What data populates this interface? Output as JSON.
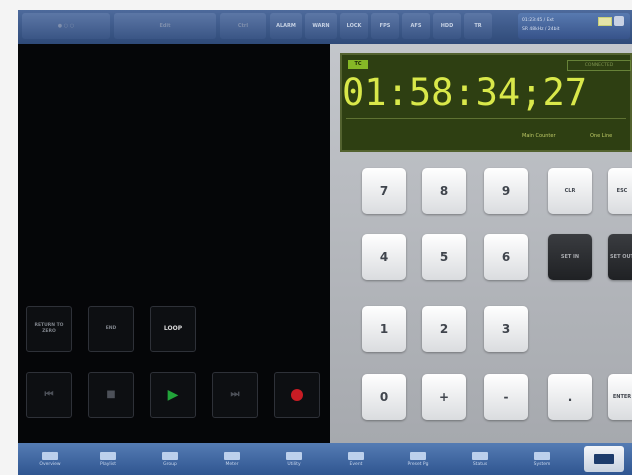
{
  "topbar": {
    "buttons": [
      {
        "label": "● ○ ○",
        "state": "dim"
      },
      {
        "label": "Edit",
        "state": "dim"
      },
      {
        "label": "Ctrl",
        "state": "dim"
      },
      {
        "label": "ALARM",
        "state": "normal"
      },
      {
        "label": "WARN",
        "state": "normal"
      },
      {
        "label": "LOCK",
        "state": "normal"
      },
      {
        "label": "FPS",
        "state": "normal"
      },
      {
        "label": "AFS",
        "state": "normal"
      },
      {
        "label": "HDD",
        "state": "normal"
      },
      {
        "label": "TR",
        "state": "normal"
      }
    ],
    "info_line1": "01:23:45 / Ext",
    "info_line2": "SR 48kHz / 24bit"
  },
  "transport": {
    "return_to_zero": "RETURN TO ZERO",
    "end": "END",
    "loop": "LOOP",
    "rewind_icon": "⏮",
    "stop_icon": "■",
    "play_icon": "▶",
    "fast_forward_icon": "⏭"
  },
  "display": {
    "mode": "TC",
    "connected": "CONNECTED",
    "timecode": "01:58:34;27",
    "main_counter": "Main Counter",
    "one_line": "One Line"
  },
  "keypad": {
    "k7": "7",
    "k8": "8",
    "k9": "9",
    "clr": "CLR",
    "esc": "ESC",
    "k4": "4",
    "k5": "5",
    "k6": "6",
    "set_in": "SET IN",
    "set_out": "SET OUT",
    "k1": "1",
    "k2": "2",
    "k3": "3",
    "k0": "0",
    "plus": "+",
    "minus": "-",
    "dot": ".",
    "enter": "ENTER"
  },
  "bottombar": [
    {
      "label": "Overview"
    },
    {
      "label": "Playlist"
    },
    {
      "label": "Group"
    },
    {
      "label": "Meter"
    },
    {
      "label": "Utility"
    },
    {
      "label": "Event"
    },
    {
      "label": "Preset Pg"
    },
    {
      "label": "Status"
    },
    {
      "label": "System"
    }
  ]
}
